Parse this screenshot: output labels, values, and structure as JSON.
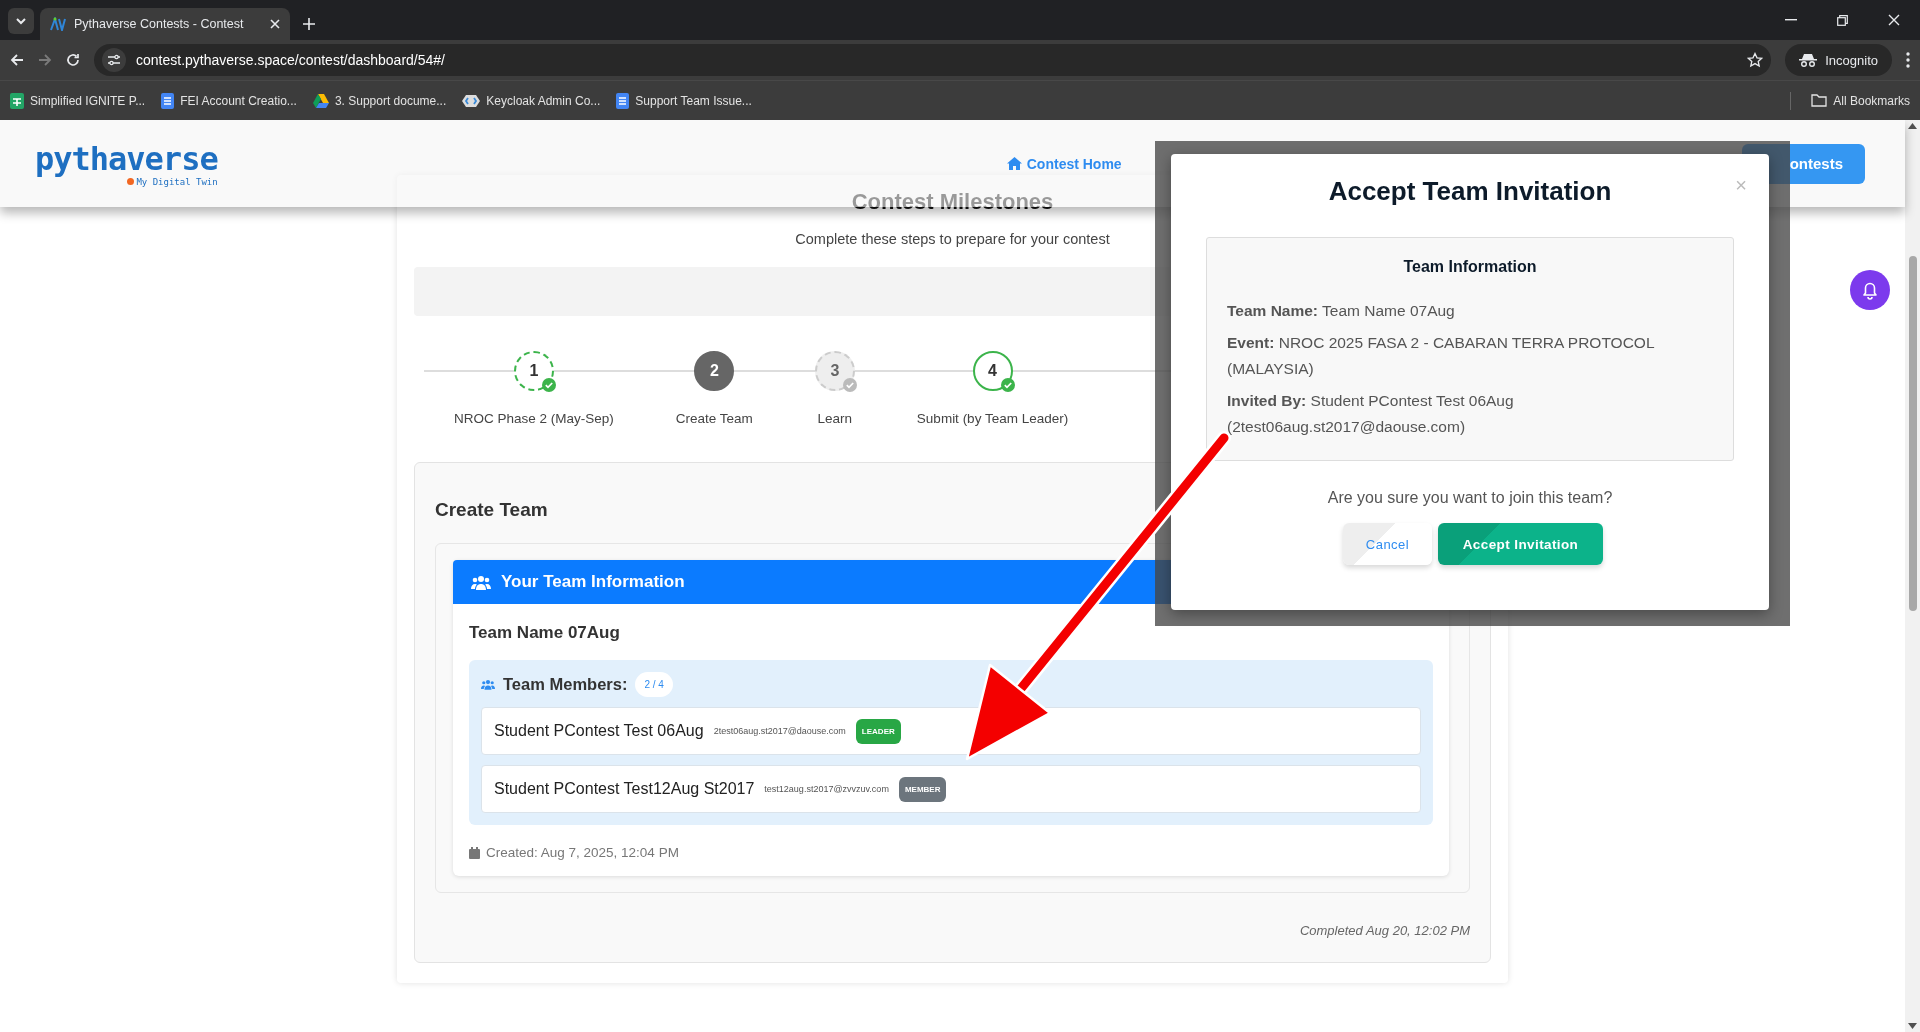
{
  "browser": {
    "tab_title": "Pythaverse Contests - Contest",
    "url": "contest.pythaverse.space/contest/dashboard/54#/",
    "forward": {
      "disabled": true
    },
    "profile": "Incognito",
    "bookmarks": [
      {
        "label": "Simplified IGNITE P...",
        "kind": "sheet"
      },
      {
        "label": "FEI Account Creatio...",
        "kind": "doc"
      },
      {
        "label": "3. Support docume...",
        "kind": "drive"
      },
      {
        "label": "Keycloak Admin Co...",
        "kind": "keycloak"
      },
      {
        "label": "Support Team Issue...",
        "kind": "doc"
      }
    ],
    "all_bookmarks": "All Bookmarks"
  },
  "header": {
    "logo": "pythaverse",
    "tagline": "My Digital Twin",
    "nav": [
      {
        "label": "Contest Home"
      }
    ],
    "contests_button": "ontests"
  },
  "milestones": {
    "title": "Contest Milestones",
    "subtitle": "Complete these steps to prepare for your contest",
    "steps": [
      {
        "number": "1",
        "label": "NROC Phase 2 (May-Sep)",
        "completed": true,
        "current": false,
        "dashed": true
      },
      {
        "number": "2",
        "label": "Create Team",
        "completed": false,
        "current": true,
        "dashed": false
      },
      {
        "number": "3",
        "label": "Learn",
        "completed": false,
        "current": false,
        "dashed": true
      },
      {
        "number": "4",
        "label": "Submit (by Team Leader)",
        "completed": true,
        "current": false,
        "dashed": false
      }
    ]
  },
  "create_team": {
    "heading": "Create Team",
    "panel_title": "Your Team Information",
    "team_name": "Team Name 07Aug",
    "members_label": "Team Members:",
    "member_count": "2 / 4",
    "members": [
      {
        "name": "Student PContest Test 06Aug",
        "email": "2test06aug.st2017@daouse.com",
        "role": "LEADER",
        "kind": "leader"
      },
      {
        "name": "Student PContest Test12Aug St2017",
        "email": "test12aug.st2017@zvvzuv.com",
        "role": "MEMBER",
        "kind": "member"
      }
    ],
    "created": "Created: Aug 7, 2025, 12:04 PM",
    "completed": "Completed Aug 20, 12:02 PM"
  },
  "modal": {
    "title": "Accept Team Invitation",
    "close": "×",
    "section_title": "Team Information",
    "fields": [
      {
        "label": "Team Name:",
        "value": "Team Name 07Aug"
      },
      {
        "label": "Event:",
        "value": "NROC 2025 FASA 2 - CABARAN TERRA PROTOCOL (MALAYSIA)"
      },
      {
        "label": "Invited By:",
        "value": "Student PContest Test 06Aug (2test06aug.st2017@daouse.com)"
      }
    ],
    "question": "Are you sure you want to join this team?",
    "cancel": "Cancel",
    "accept": "Accept Invitation"
  }
}
